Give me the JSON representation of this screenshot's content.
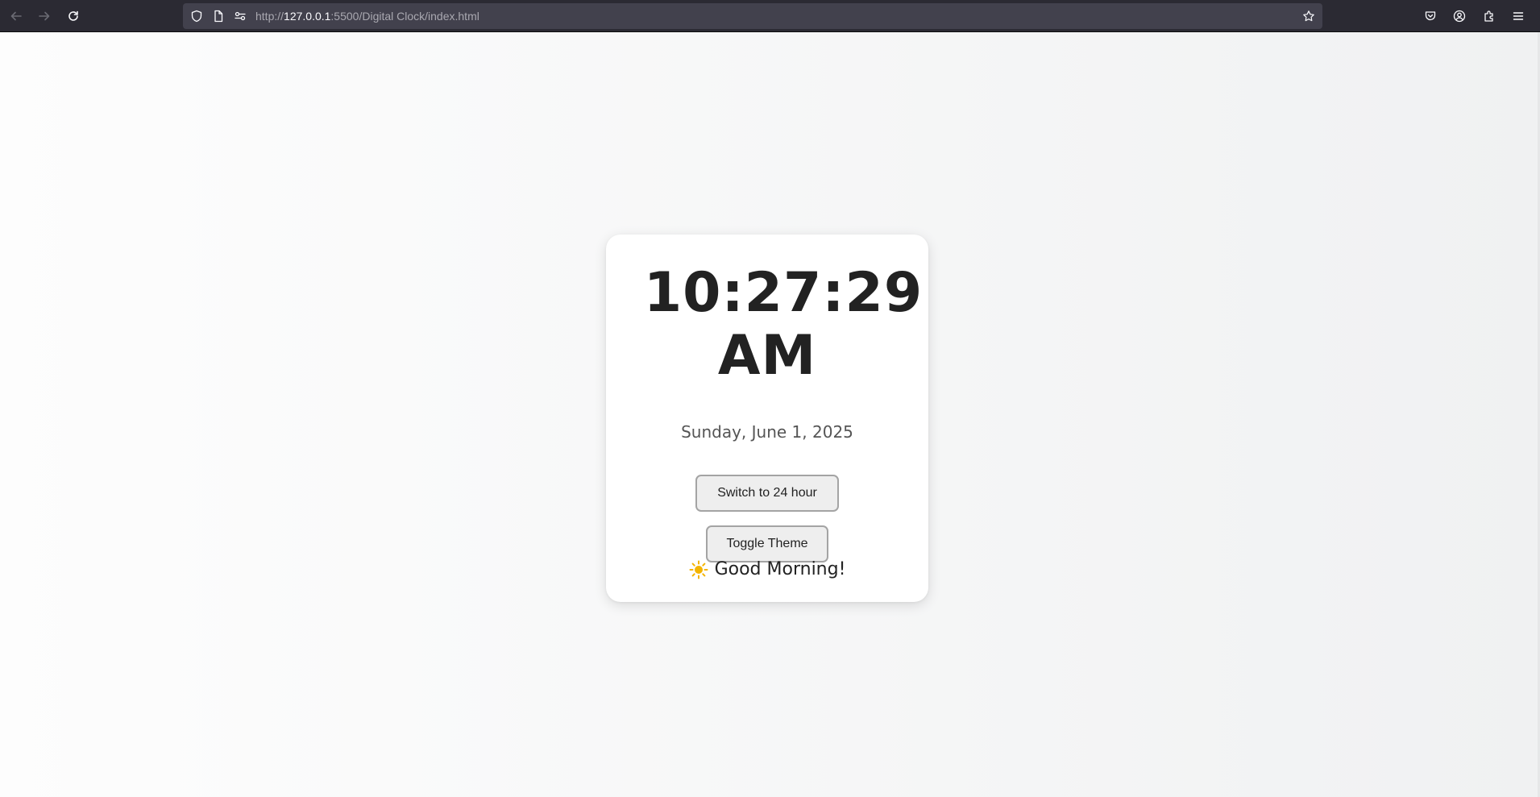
{
  "browser": {
    "url_scheme": "http://",
    "url_host": "127.0.0.1",
    "url_rest": ":5500/Digital Clock/index.html",
    "icons": [
      "back-icon",
      "forward-icon",
      "reload-icon",
      "shield-icon",
      "page-icon",
      "permissions-icon",
      "bookmark-star-icon",
      "pocket-icon",
      "account-icon",
      "extensions-icon",
      "menu-icon"
    ]
  },
  "clock": {
    "time": "10:27:29",
    "period": "AM",
    "date": "Sunday, June 1, 2025",
    "format_button_label": "Switch to 24 hour",
    "theme_button_label": "Toggle Theme",
    "greeting": "Good Morning!",
    "greeting_icon": "sun-icon"
  },
  "colors": {
    "card_bg": "#ffffff",
    "page_bg_start": "#fdfdfd",
    "page_bg_end": "#f0f1f2",
    "time_text": "#222222",
    "date_text": "#555555",
    "button_bg": "#eeeeee",
    "button_border": "#a4a4a4",
    "sun": "#f4b400"
  }
}
